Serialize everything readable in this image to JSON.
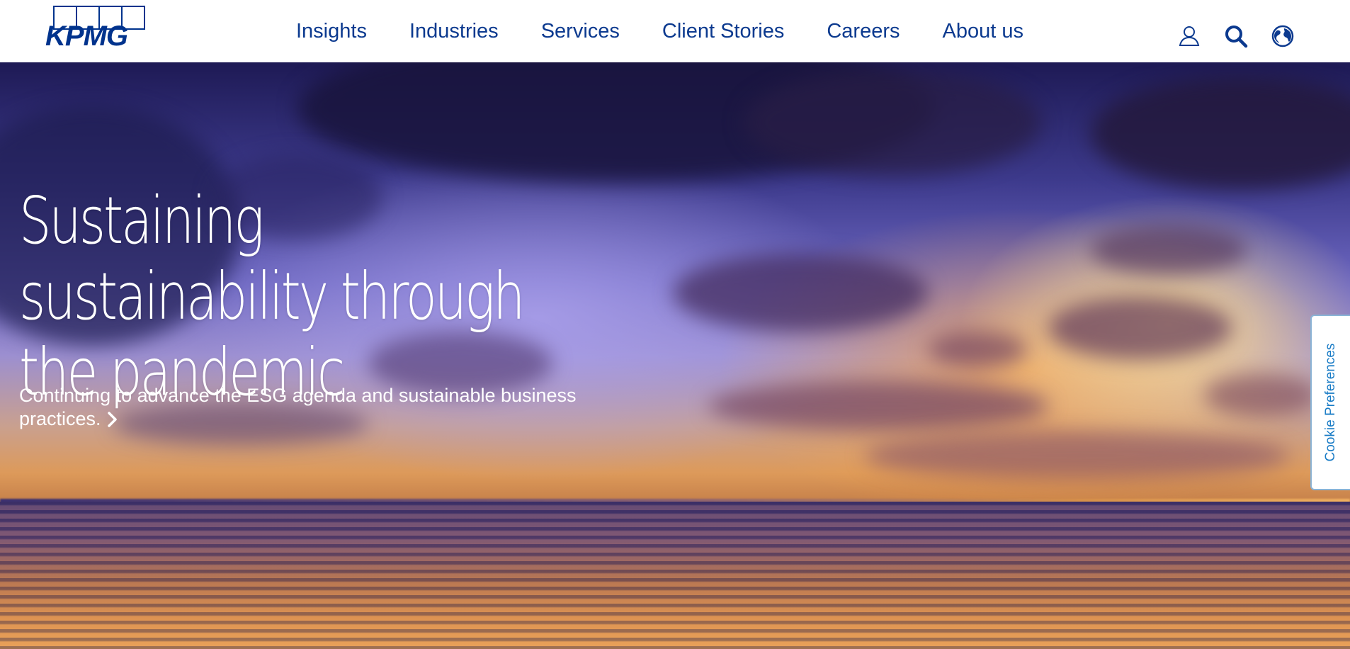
{
  "brand": {
    "name": "KPMG",
    "color": "#00338D"
  },
  "nav": {
    "items": [
      {
        "label": "Insights"
      },
      {
        "label": "Industries"
      },
      {
        "label": "Services"
      },
      {
        "label": "Client Stories"
      },
      {
        "label": "Careers"
      },
      {
        "label": "About us"
      }
    ]
  },
  "header_icons": [
    "user-icon",
    "search-icon",
    "globe-icon"
  ],
  "hero": {
    "title": "Sustaining sustainability through the pandemic",
    "subtitle": "Continuing to advance the ESG agenda and sustainable business practices."
  },
  "cookie": {
    "label": "Cookie Preferences",
    "color": "#1a7cc6"
  }
}
